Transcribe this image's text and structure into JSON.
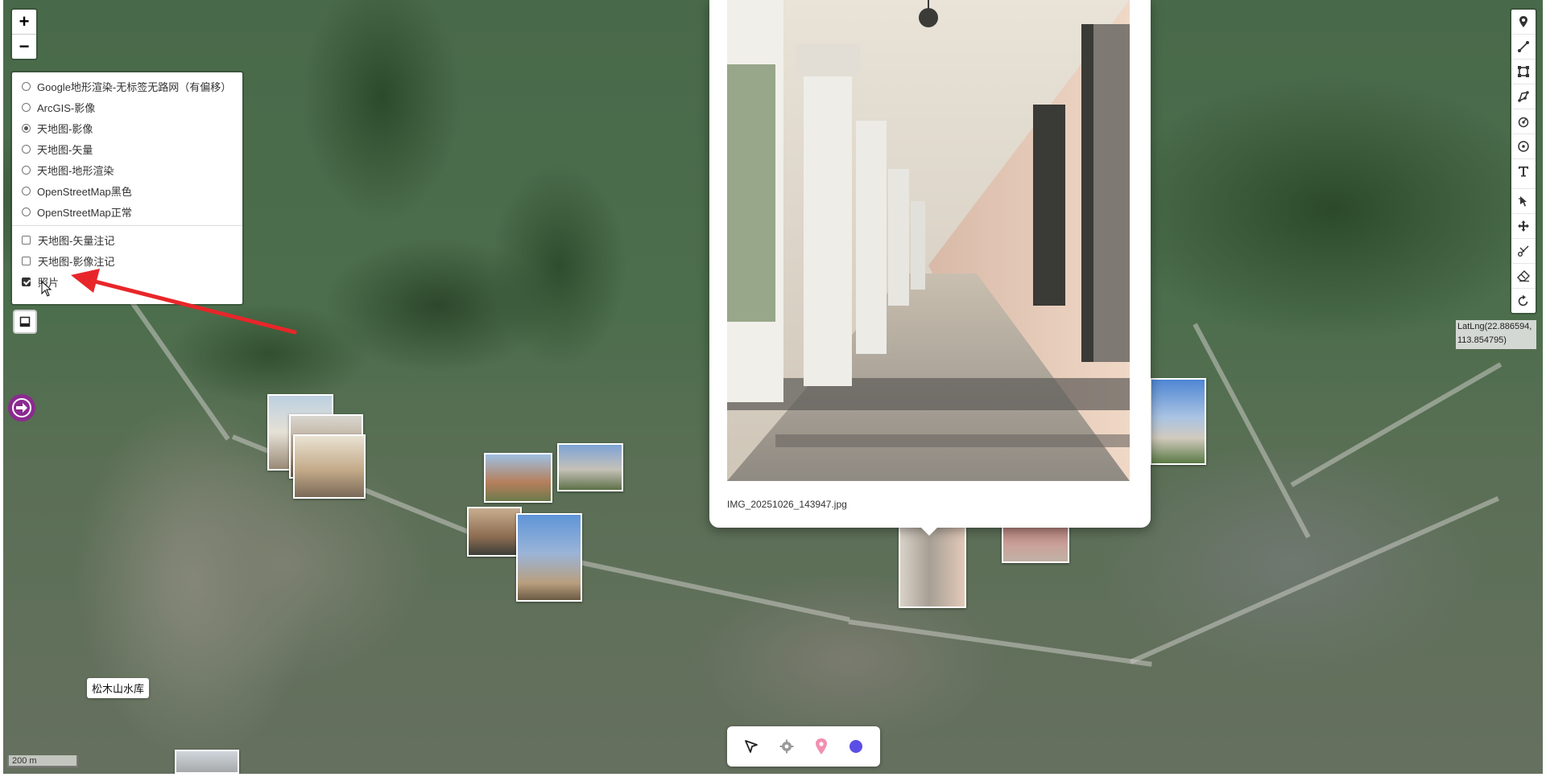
{
  "zoom": {
    "in_label": "+",
    "out_label": "−"
  },
  "layer_control": {
    "base_layers": [
      {
        "label": "Google地形渲染-无标签无路网（有偏移）",
        "selected": false
      },
      {
        "label": "ArcGIS-影像",
        "selected": false
      },
      {
        "label": "天地图-影像",
        "selected": true
      },
      {
        "label": "天地图-矢量",
        "selected": false
      },
      {
        "label": "天地图-地形渲染",
        "selected": false
      },
      {
        "label": "OpenStreetMap黑色",
        "selected": false
      },
      {
        "label": "OpenStreetMap正常",
        "selected": false
      }
    ],
    "overlays": [
      {
        "label": "天地图-矢量注记",
        "checked": false
      },
      {
        "label": "天地图-影像注记",
        "checked": false
      },
      {
        "label": "照片",
        "checked": true
      }
    ]
  },
  "popup": {
    "caption": "IMG_20251026_143947.jpg"
  },
  "coords": {
    "line1": "LatLng(22.886594,",
    "line2": "113.854795)"
  },
  "map_label": {
    "text": "松木山水库"
  },
  "scale": {
    "text": "200 m"
  },
  "toolbar": {
    "tools": [
      "marker-icon",
      "polyline-icon",
      "rectangle-icon",
      "polygon-icon",
      "circle-marker-icon",
      "circle-icon",
      "text-icon",
      "cut-icon",
      "drag-icon",
      "scissors-icon",
      "eraser-icon",
      "rotate-icon"
    ]
  },
  "bottom_bar": {
    "items": [
      "select-arrow-icon",
      "settings-gear-icon",
      "location-pin-icon",
      "color-dot-icon"
    ],
    "accent_color": "#5b4ee6",
    "pin_color": "#f28fb0"
  },
  "colors": {
    "annotation_arrow": "#e8262a",
    "nav_circle": "#8a2b8f"
  }
}
